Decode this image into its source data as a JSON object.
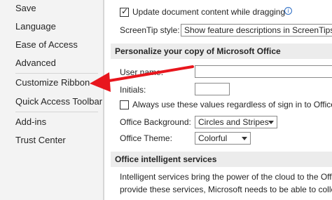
{
  "nav": {
    "items": [
      {
        "label": "Save"
      },
      {
        "label": "Language"
      },
      {
        "label": "Ease of Access"
      },
      {
        "label": "Advanced"
      },
      {
        "label": "Customize Ribbon"
      },
      {
        "label": "Quick Access Toolbar"
      },
      {
        "label": "Add-ins"
      },
      {
        "label": "Trust Center"
      }
    ]
  },
  "display": {
    "update_while_dragging_label": "Update document content while dragging",
    "update_while_dragging_checked": true,
    "screentip_label": "ScreenTip style:",
    "screentip_value": "Show feature descriptions in ScreenTips"
  },
  "personalize": {
    "header": "Personalize your copy of Microsoft Office",
    "username_label": "User name:",
    "username_value": "",
    "initials_label": "Initials:",
    "initials_value": "",
    "always_use_label": "Always use these values regardless of sign in to Office.",
    "always_use_checked": false,
    "background_label": "Office Background:",
    "background_value": "Circles and Stripes",
    "theme_label": "Office Theme:",
    "theme_value": "Colorful"
  },
  "intelligent": {
    "header": "Office intelligent services",
    "line1": "Intelligent services bring the power of the cloud to the Offi",
    "line2": "provide these services, Microsoft needs to be able to collec"
  },
  "annotation": {
    "arrow_color": "#e8161d"
  }
}
